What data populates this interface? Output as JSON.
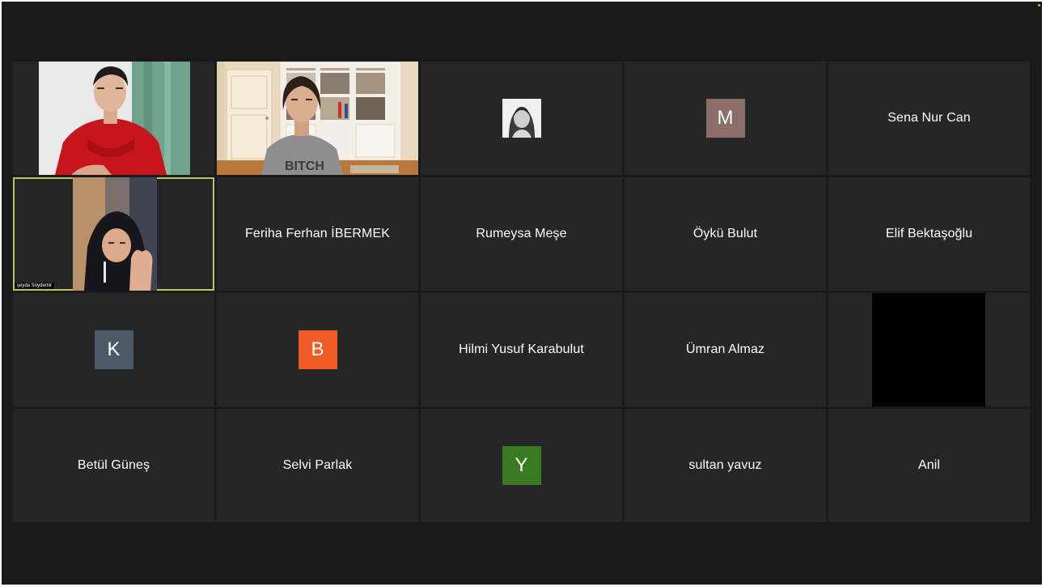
{
  "participants": [
    {
      "id": "p1",
      "kind": "video"
    },
    {
      "id": "p2",
      "kind": "video"
    },
    {
      "id": "p3",
      "kind": "photo"
    },
    {
      "id": "p4",
      "kind": "initial",
      "initial": "M",
      "color": "#8b6f66"
    },
    {
      "id": "p5",
      "kind": "name",
      "name": "Sena Nur Can"
    },
    {
      "id": "p6",
      "kind": "video",
      "name": "şeyda Soydemir",
      "active": true
    },
    {
      "id": "p7",
      "kind": "name",
      "name": "Feriha Ferhan İBERMEK"
    },
    {
      "id": "p8",
      "kind": "name",
      "name": "Rumeysa Meşe"
    },
    {
      "id": "p9",
      "kind": "name",
      "name": "Öykü Bulut"
    },
    {
      "id": "p10",
      "kind": "name",
      "name": "Elif Bektaşoğlu"
    },
    {
      "id": "p11",
      "kind": "initial",
      "initial": "K",
      "color": "#4b5a66"
    },
    {
      "id": "p12",
      "kind": "initial",
      "initial": "B",
      "color": "#f15a24"
    },
    {
      "id": "p13",
      "kind": "name",
      "name": "Hilmi Yusuf Karabulut"
    },
    {
      "id": "p14",
      "kind": "name",
      "name": "Ümran Almaz"
    },
    {
      "id": "p15",
      "kind": "black"
    },
    {
      "id": "p16",
      "kind": "name",
      "name": "Betül Güneş"
    },
    {
      "id": "p17",
      "kind": "name",
      "name": "Selvi Parlak"
    },
    {
      "id": "p18",
      "kind": "initial",
      "initial": "Y",
      "color": "#3a7a23"
    },
    {
      "id": "p19",
      "kind": "name",
      "name": "sultan yavuz"
    },
    {
      "id": "p20",
      "kind": "name",
      "name": "Anil"
    }
  ],
  "theme": {
    "background": "#1a1a1a",
    "tile": "#262626",
    "active_border": "#b8c95a"
  }
}
